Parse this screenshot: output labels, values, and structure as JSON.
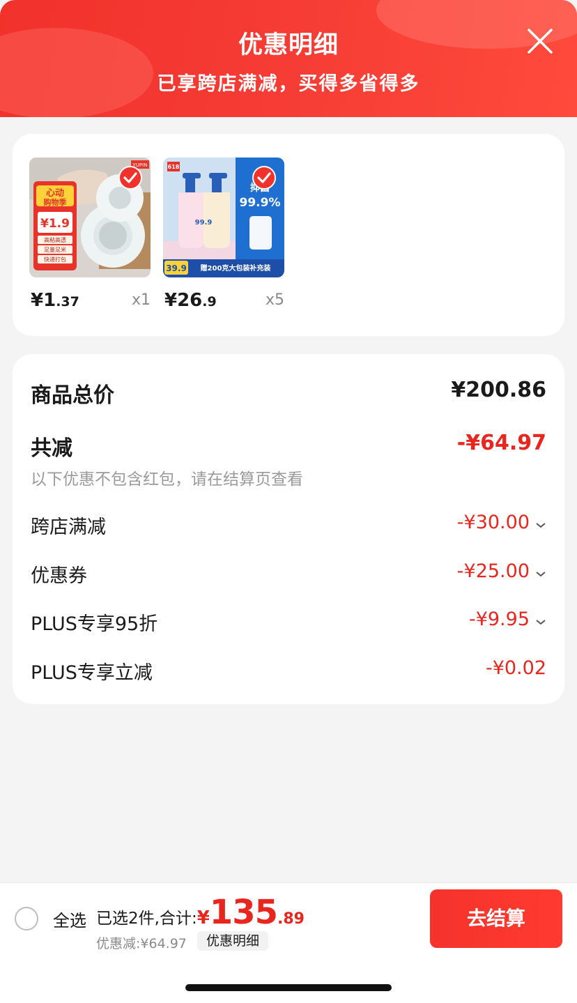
{
  "header": {
    "title": "优惠明细",
    "subtitle": "已享跨店满减，买得多省得多"
  },
  "products": [
    {
      "price_currency": "¥",
      "price_int": "1",
      "price_dec": ".37",
      "qty": "x1",
      "image_texts": {
        "brand": "YUPIN",
        "promo": "心动购物季",
        "price": "¥1.9",
        "tags": [
          "高粘高透",
          "足量足米",
          "快递打包"
        ]
      }
    },
    {
      "price_currency": "¥",
      "price_int": "26",
      "price_dec": ".9",
      "qty": "x5",
      "image_texts": {
        "badge": "618",
        "big": "99.9%",
        "price": "39.9",
        "promo": "赠200克大包装补充装"
      }
    }
  ],
  "summary": {
    "goods_total_label": "商品总价",
    "goods_total_value": "¥200.86",
    "total_reduce_label": "共减",
    "total_reduce_value": "-¥64.97",
    "note": "以下优惠不包含红包，请在结算页查看",
    "items": [
      {
        "label": "跨店满减",
        "value": "-¥30.00",
        "expandable": true
      },
      {
        "label": "优惠券",
        "value": "-¥25.00",
        "expandable": true
      },
      {
        "label": "PLUS专享95折",
        "value": "-¥9.95",
        "expandable": true
      },
      {
        "label": "PLUS专享立减",
        "value": "-¥0.02",
        "expandable": false
      }
    ]
  },
  "bottom": {
    "select_all": "全选",
    "selected_text": "已选2件,合计:",
    "total_currency": "¥",
    "total_int": "135",
    "total_dec": ".89",
    "saved_text": "优惠减:¥64.97",
    "detail_button": "优惠明细",
    "checkout_button": "去结算"
  },
  "colors": {
    "accent": "#f2312b",
    "price_red": "#e8261d",
    "background": "#f4f4f4"
  }
}
